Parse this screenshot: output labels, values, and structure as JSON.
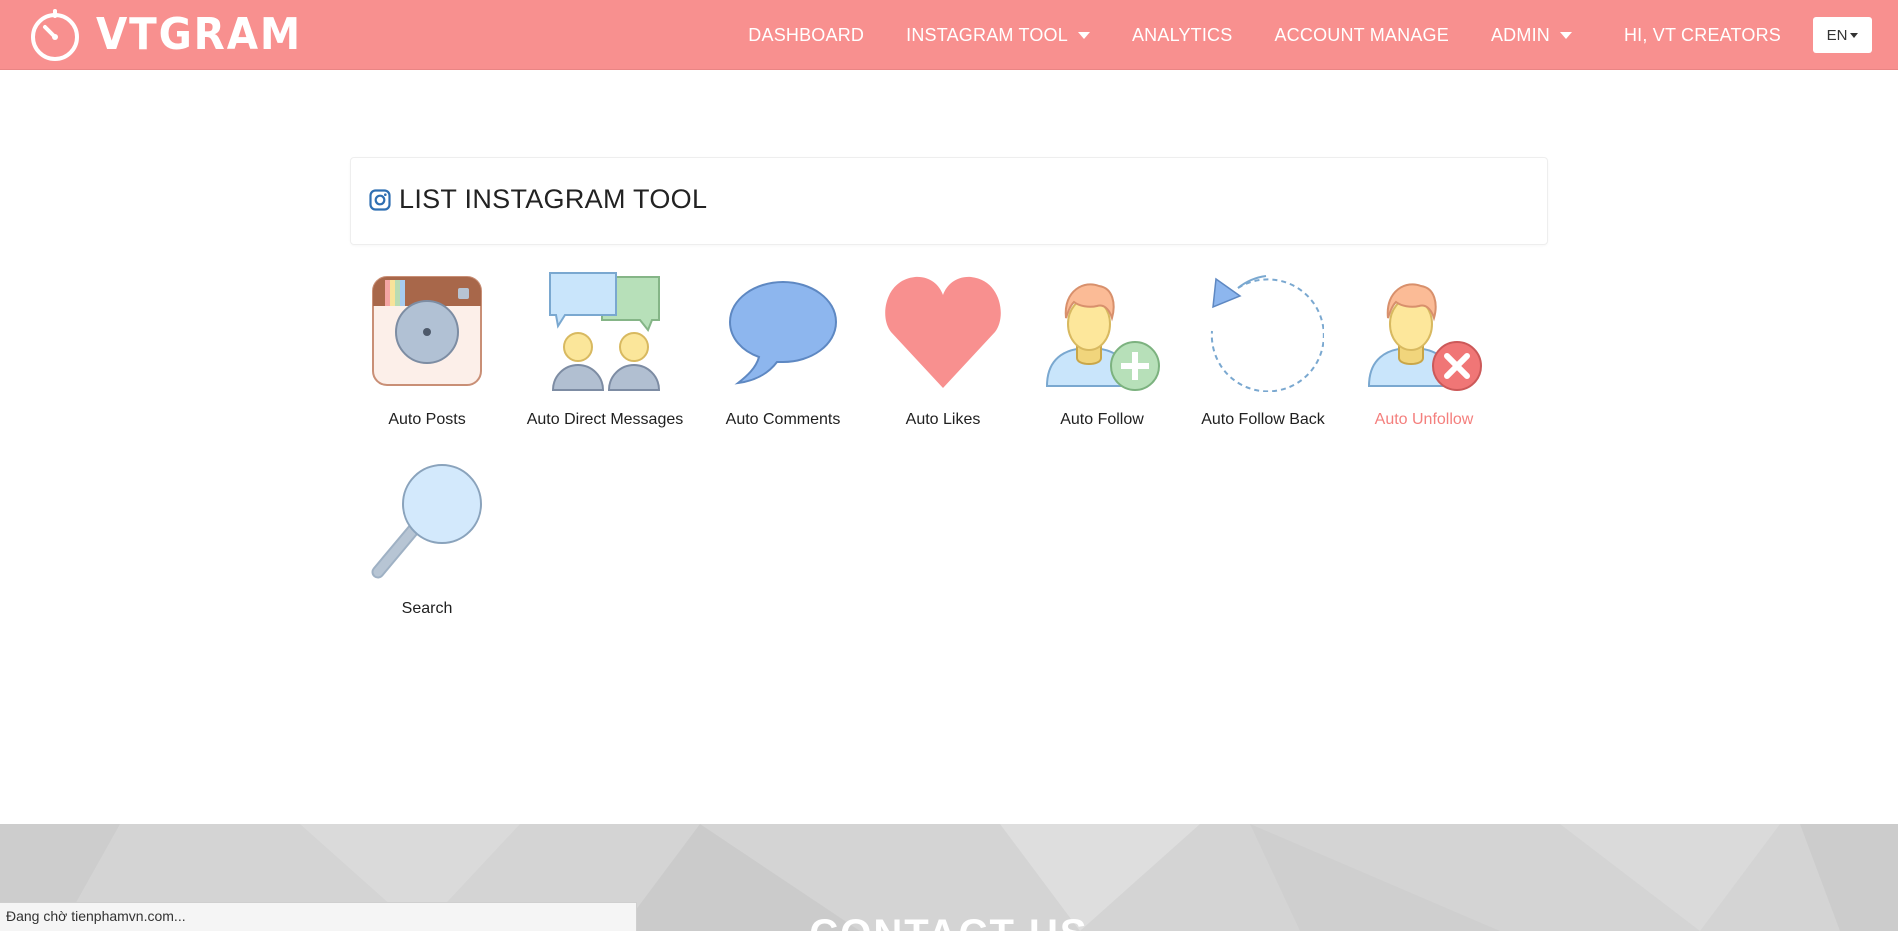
{
  "brand": {
    "name": "VTGRAM"
  },
  "nav": {
    "items": [
      {
        "label": "DASHBOARD",
        "dropdown": false
      },
      {
        "label": "INSTAGRAM TOOL",
        "dropdown": true
      },
      {
        "label": "ANALYTICS",
        "dropdown": false
      },
      {
        "label": "ACCOUNT MANAGE",
        "dropdown": false
      },
      {
        "label": "ADMIN",
        "dropdown": true
      }
    ],
    "greeting": "HI, VT CREATORS",
    "language": "EN"
  },
  "panel": {
    "title": "LIST INSTAGRAM TOOL",
    "icon": "instagram-icon"
  },
  "tools": [
    {
      "label": "Auto Posts",
      "icon": "camera-icon"
    },
    {
      "label": "Auto Direct Messages",
      "icon": "chat-users-icon"
    },
    {
      "label": "Auto Comments",
      "icon": "speech-bubble-icon"
    },
    {
      "label": "Auto Likes",
      "icon": "heart-icon"
    },
    {
      "label": "Auto Follow",
      "icon": "add-user-icon"
    },
    {
      "label": "Auto Follow Back",
      "icon": "refresh-icon"
    },
    {
      "label": "Auto Unfollow",
      "icon": "remove-user-icon",
      "active": true
    },
    {
      "label": "Search",
      "icon": "magnifier-icon"
    }
  ],
  "footer": {
    "heading": "CONTACT US"
  },
  "status_bar": {
    "text": "Đang chờ tienphamvn.com..."
  },
  "colors": {
    "brand": "#f8908f",
    "active_label": "#f47f7d",
    "footer": "#d4d4d4"
  }
}
